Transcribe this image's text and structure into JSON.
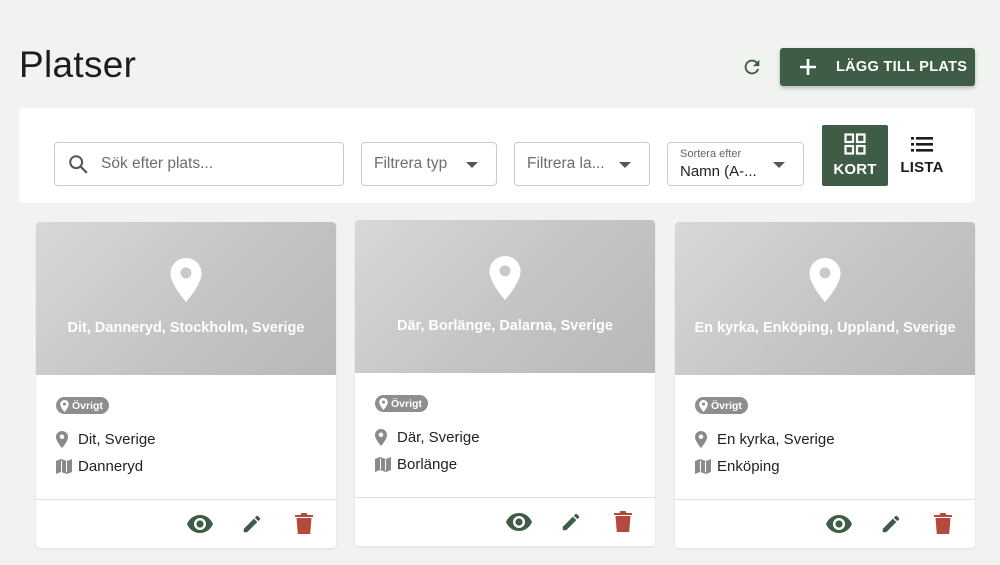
{
  "page": {
    "title": "Platser"
  },
  "header": {
    "add_label": "LÄGG TILL PLATS"
  },
  "toolbar": {
    "search_placeholder": "Sök efter plats...",
    "filter_type": "Filtrera typ",
    "filter_land": "Filtrera la...",
    "sort_label": "Sortera efter",
    "sort_value": "Namn (A-...",
    "view_kort": "KORT",
    "view_lista": "LISTA"
  },
  "cards": [
    {
      "title": "Dit, Danneryd, Stockholm, Sverige",
      "chip": "Övrigt",
      "place": "Dit, Sverige",
      "area": "Danneryd"
    },
    {
      "title": "Där, Borlänge, Dalarna, Sverige",
      "chip": "Övrigt",
      "place": "Där, Sverige",
      "area": "Borlänge"
    },
    {
      "title": "En kyrka, Enköping, Uppland, Sverige",
      "chip": "Övrigt",
      "place": "En kyrka, Sverige",
      "area": "Enköping"
    }
  ],
  "colors": {
    "primary": "#3e5c46",
    "delete": "#b24a3d",
    "background": "#f1f3f1",
    "chip": "#8e8e8e"
  },
  "icons": [
    "refresh-icon",
    "plus-icon",
    "search-icon",
    "grid-icon",
    "list-icon",
    "location-pin-icon",
    "map-icon",
    "eye-icon",
    "pencil-icon",
    "trash-icon"
  ]
}
